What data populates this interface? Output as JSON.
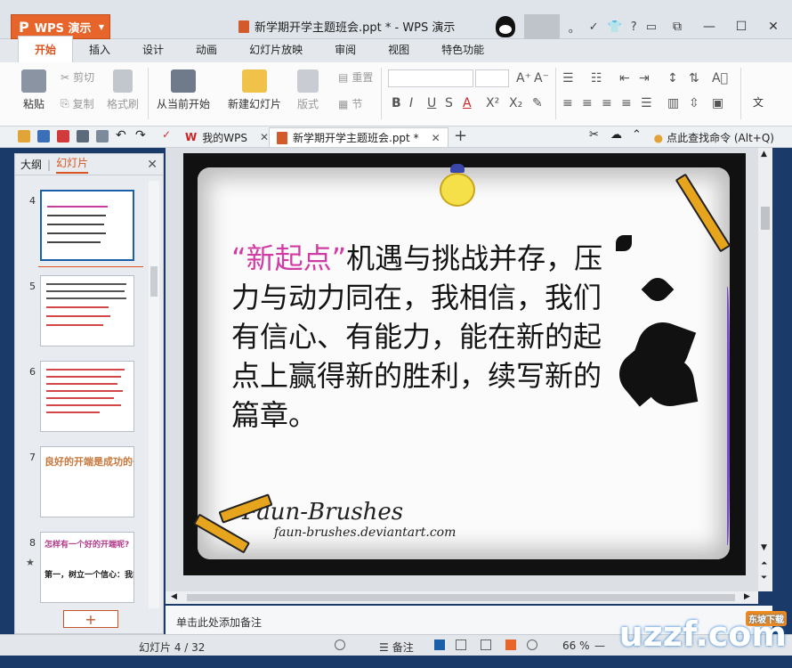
{
  "titlebar": {
    "app_button": "WPS 演示",
    "window_title": "新学期开学主题班会.ppt * - WPS 演示"
  },
  "menu": {
    "tabs": [
      "开始",
      "插入",
      "设计",
      "动画",
      "幻灯片放映",
      "审阅",
      "视图",
      "特色功能"
    ],
    "active_index": 0
  },
  "ribbon": {
    "paste": "粘贴",
    "cut": "剪切",
    "copy": "复制",
    "format_painter": "格式刷",
    "from_current": "从当前开始",
    "new_slide": "新建幻灯片",
    "layout": "版式",
    "reset": "重置",
    "section": "节",
    "text_label": "文"
  },
  "quickbar": {
    "tab_mywps": "我的WPS",
    "tab_doc": "新学期开学主题班会.ppt *",
    "help_search": "点此查找命令 (Alt+Q)"
  },
  "leftpane": {
    "tab_outline": "大纲",
    "tab_slides": "幻灯片",
    "thumbnails": [
      {
        "num": "4",
        "selected": true
      },
      {
        "num": "5",
        "selected": false
      },
      {
        "num": "6",
        "selected": false
      },
      {
        "num": "7",
        "selected": false
      },
      {
        "num": "8",
        "selected": false
      }
    ],
    "thumb7_text": "良好的开端是成功的一半",
    "thumb8_line1": "怎样有一个好的开端呢?",
    "thumb8_line2": "第一，树立一个信心：我能行"
  },
  "slide": {
    "highlight": "“新起点”",
    "body": "机遇与挑战并存，压力与动力同在，我相信，我们有信心、有能力，能在新的起点上赢得新的胜利，续写新的篇章。",
    "watermark_line1": "Faun-Brushes",
    "watermark_line2": "faun-brushes.deviantart.com"
  },
  "notes": {
    "placeholder": "单击此处添加备注"
  },
  "status": {
    "slide_info": "幻灯片 4 / 32",
    "notes_button": "备注",
    "zoom": "66 %"
  },
  "logo": {
    "text": "uzzf.com",
    "badge": "东坡下载"
  },
  "colors": {
    "accent": "#e7642a",
    "highlight": "#d03ba6",
    "selection": "#1b5fa8"
  }
}
